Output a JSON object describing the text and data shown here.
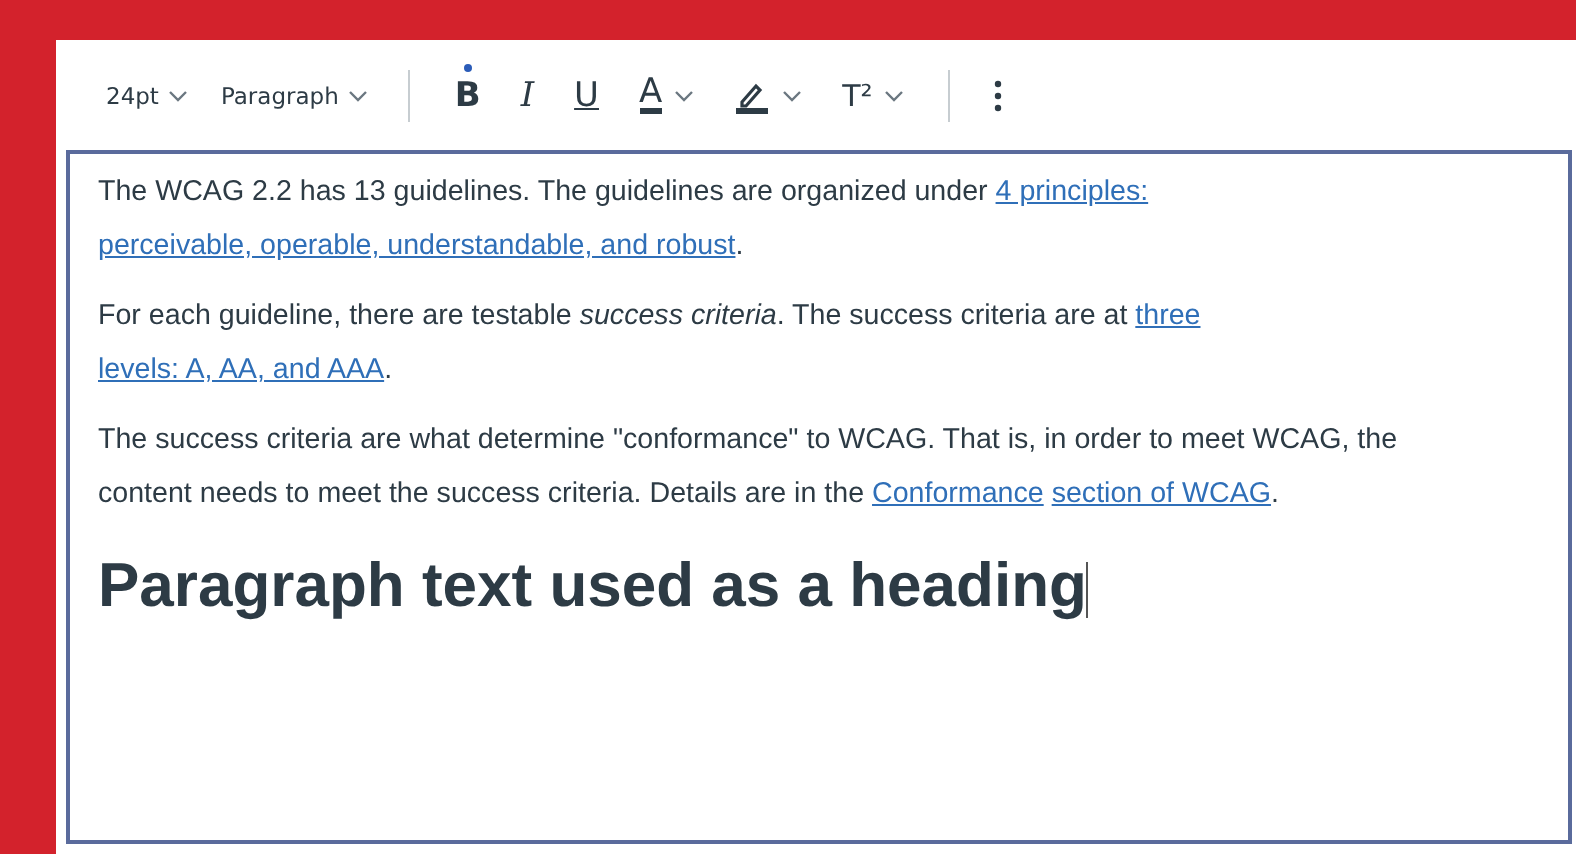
{
  "toolbar": {
    "items": [
      {
        "kind": "dropdown",
        "label": "24pt"
      },
      {
        "kind": "dropdown",
        "label": "Paragraph"
      },
      {
        "kind": "separator"
      },
      {
        "kind": "bold",
        "label": "B",
        "active": true
      },
      {
        "kind": "italic",
        "label": "I",
        "active": false
      },
      {
        "kind": "underline",
        "label": "U",
        "active": false
      },
      {
        "kind": "textcolor",
        "label": "A"
      },
      {
        "kind": "highlight"
      },
      {
        "kind": "superscript",
        "label": "T²"
      },
      {
        "kind": "separator"
      },
      {
        "kind": "more"
      }
    ]
  },
  "editor": {
    "paragraphs": [
      {
        "kind": "body",
        "parts": [
          {
            "kind": "text",
            "text": "The WCAG 2.2 has 13 guidelines. The guidelines are organized under "
          },
          {
            "kind": "link",
            "text": "4 principles:"
          },
          {
            "kind": "space"
          },
          {
            "kind": "link",
            "text": "perceivable, operable, understandable, and robust"
          },
          {
            "kind": "text",
            "text": "."
          }
        ]
      },
      {
        "kind": "body",
        "parts": [
          {
            "kind": "text",
            "text": "For each guideline, there are testable *success criteria*. The success criteria are at "
          },
          {
            "kind": "link",
            "text": "three"
          },
          {
            "kind": "space"
          },
          {
            "kind": "link",
            "text": "levels: A, AA, and AAA"
          },
          {
            "kind": "text",
            "text": "."
          }
        ]
      },
      {
        "kind": "body",
        "parts": [
          {
            "kind": "text",
            "text": "The success criteria are what determine \"conformance\" to WCAG. That is, in order to meet WCAG, the content needs to meet the success criteria. Details are in the "
          },
          {
            "kind": "link",
            "text": "Conformance"
          },
          {
            "kind": "space"
          },
          {
            "kind": "link",
            "text": "section of WCAG"
          },
          {
            "kind": "text",
            "text": "."
          }
        ]
      },
      {
        "kind": "large",
        "parts": [
          {
            "kind": "text",
            "text": "Paragraph text used as a heading"
          }
        ]
      }
    ]
  }
}
